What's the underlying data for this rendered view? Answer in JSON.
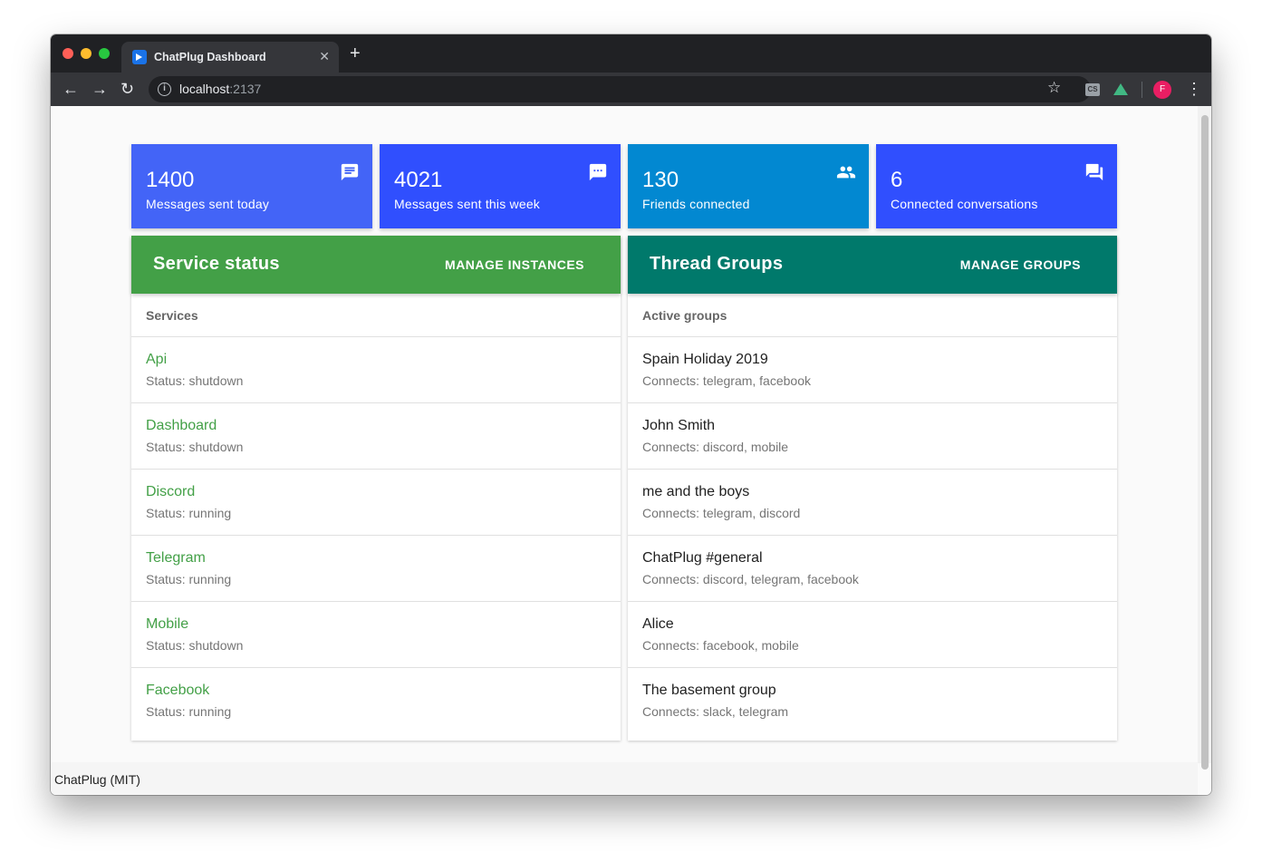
{
  "browser": {
    "tab_title": "ChatPlug Dashboard",
    "url_host": "localhost",
    "url_port": ":2137",
    "avatar_initial": "F",
    "ext1_label": "CS"
  },
  "stats": [
    {
      "value": "1400",
      "label": "Messages sent today",
      "color": "#4364f7",
      "icon": "message-icon"
    },
    {
      "value": "4021",
      "label": "Messages sent this week",
      "color": "#304ffe",
      "icon": "chat-bubble-icon"
    },
    {
      "value": "130",
      "label": "Friends connected",
      "color": "#0288d1",
      "icon": "people-icon"
    },
    {
      "value": "6",
      "label": "Connected conversations",
      "color": "#304ffe",
      "icon": "forum-icon"
    }
  ],
  "services_panel": {
    "title": "Service status",
    "action": "MANAGE INSTANCES",
    "color": "#43a047",
    "subheader": "Services",
    "items": [
      {
        "name": "Api",
        "status": "Status: shutdown"
      },
      {
        "name": "Dashboard",
        "status": "Status: shutdown"
      },
      {
        "name": "Discord",
        "status": "Status: running"
      },
      {
        "name": "Telegram",
        "status": "Status: running"
      },
      {
        "name": "Mobile",
        "status": "Status: shutdown"
      },
      {
        "name": "Facebook",
        "status": "Status: running"
      }
    ]
  },
  "groups_panel": {
    "title": "Thread Groups",
    "action": "MANAGE GROUPS",
    "color": "#00796b",
    "subheader": "Active groups",
    "items": [
      {
        "name": "Spain Holiday 2019",
        "connects": "Connects: telegram, facebook"
      },
      {
        "name": "John Smith",
        "connects": "Connects: discord, mobile"
      },
      {
        "name": "me and the boys",
        "connects": "Connects: telegram, discord"
      },
      {
        "name": "ChatPlug #general",
        "connects": "Connects: discord, telegram, facebook"
      },
      {
        "name": "Alice",
        "connects": "Connects: facebook, mobile"
      },
      {
        "name": "The basement group",
        "connects": "Connects: slack, telegram"
      }
    ]
  },
  "footer": {
    "text": "ChatPlug (MIT)"
  }
}
